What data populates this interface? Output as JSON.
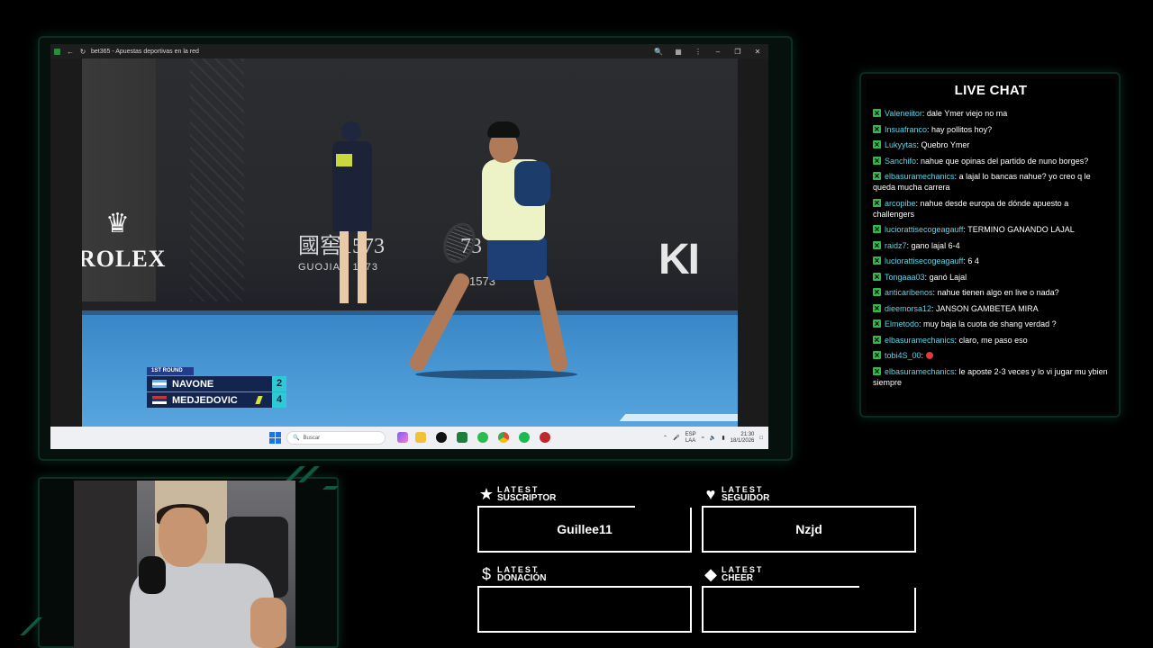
{
  "browser": {
    "title": "bet365 - Apuestas deportivas en la red",
    "taskbar": {
      "search_placeholder": "Buscar",
      "lang_top": "ESP",
      "lang_bottom": "LAA",
      "time": "21:30",
      "date": "18/1/2026"
    }
  },
  "video": {
    "ads": {
      "rolex": "ROLEX",
      "guojiao_cn": "國窖1573",
      "guojiao_latin": "GUOJIAO 1573",
      "guojiao_cn2": "73",
      "guojiao_num": "1573",
      "kia": "KI"
    },
    "scoreboard": {
      "round": "1ST ROUND",
      "players": [
        {
          "name": "NAVONE",
          "country": "ARG",
          "score": "2",
          "serving": false
        },
        {
          "name": "MEDJEDOVIC",
          "country": "SRB",
          "score": "4",
          "serving": true
        }
      ]
    }
  },
  "chat": {
    "title": "LIVE CHAT",
    "messages": [
      {
        "user": "Valeneiitor",
        "text": " dale Ymer viejo no ma"
      },
      {
        "user": "Insuafranco",
        "text": " hay pollitos hoy?"
      },
      {
        "user": "Lukyytas",
        "text": " Quebro Ymer"
      },
      {
        "user": "Sanchifo",
        "text": " nahue que opinas del partido de nuno borges?"
      },
      {
        "user": "elbasuramechanics",
        "text": " a lajal lo bancas nahue? yo creo q le queda mucha carrera"
      },
      {
        "user": "arcopibe",
        "text": " nahue desde europa de dónde apuesto a challengers"
      },
      {
        "user": "luciorattisecogeagauff",
        "text": " TERMINO GANANDO LAJAL"
      },
      {
        "user": "raidz7",
        "text": " gano lajal 6-4"
      },
      {
        "user": "luciorattisecogeagauff",
        "text": " 6 4"
      },
      {
        "user": "Tongaaa03",
        "text": " ganó Lajal"
      },
      {
        "user": "anticaribenos",
        "text": " nahue tienen algo en live o nada?"
      },
      {
        "user": "dieemorsa12",
        "text": " JANSON GAMBETEA MIRA"
      },
      {
        "user": "Elmetodo",
        "text": " muy baja la cuota de shang verdad ?"
      },
      {
        "user": "elbasuramechanics",
        "text": " claro, me paso eso"
      },
      {
        "user": "tobi4S_00",
        "text": " ",
        "emote": true
      },
      {
        "user": "elbasuramechanics",
        "text": " le aposte 2-3 veces y lo vi jugar mu ybien siempre"
      }
    ]
  },
  "widgets": {
    "suscriptor": {
      "latest": "LATEST",
      "type": "SUSCRIPTOR",
      "value": "Guillee11"
    },
    "seguidor": {
      "latest": "LATEST",
      "type": "SEGUIDOR",
      "value": "Nzjd"
    },
    "donacion": {
      "latest": "LATEST",
      "type": "DONACIÓN",
      "value": ""
    },
    "cheer": {
      "latest": "LATEST",
      "type": "CHEER",
      "value": ""
    }
  },
  "colors": {
    "accent_green": "#34b84a",
    "chat_user": "#5fd4e6",
    "frame_glow": "#0e2e22",
    "score_box": "#2ec9d4",
    "scoreboard_bg": "#13244e"
  }
}
